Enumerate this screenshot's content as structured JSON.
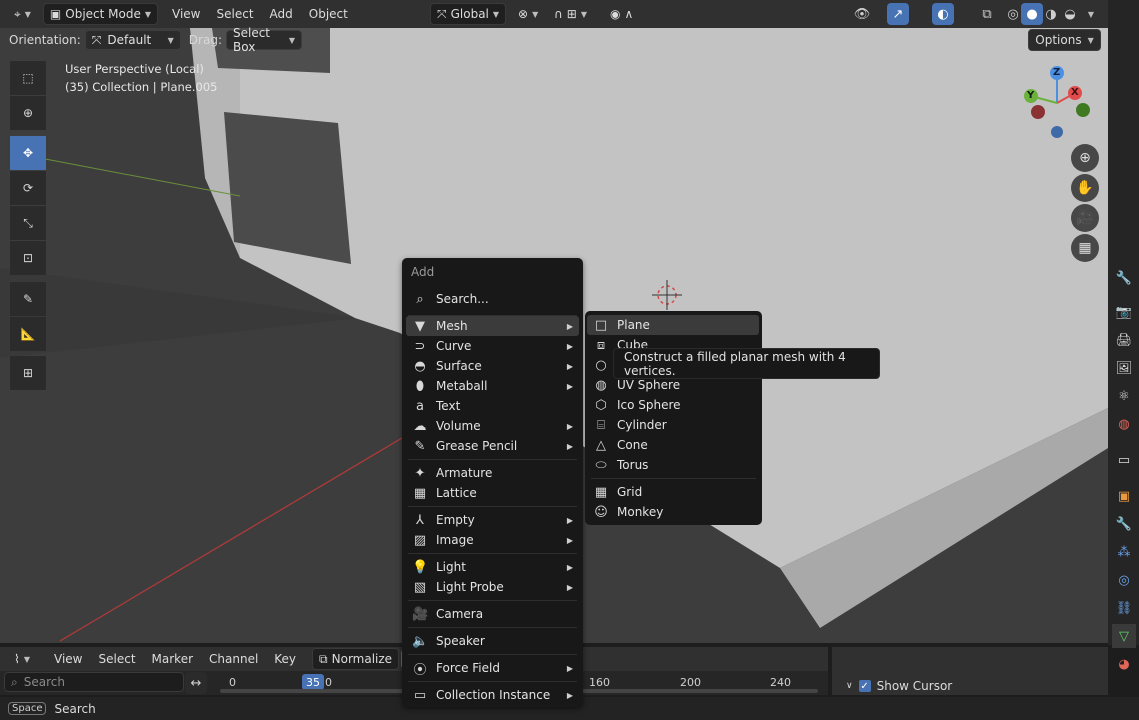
{
  "header": {
    "mode": "Object Mode",
    "menus": [
      "View",
      "Select",
      "Add",
      "Object"
    ],
    "transform_orientation": "Global"
  },
  "tool_settings": {
    "orientation_label": "Orientation:",
    "orientation_value": "Default",
    "drag_label": "Drag:",
    "drag_value": "Select Box",
    "options_label": "Options"
  },
  "viewport": {
    "perspective": "User Perspective (Local)",
    "collection": "(35) Collection | Plane.005",
    "gizmo": {
      "x": "X",
      "y": "Y",
      "z": "Z"
    }
  },
  "add_menu": {
    "title": "Add",
    "items": [
      {
        "label": "Search...",
        "icon": "search-icon",
        "submenu": false
      },
      {
        "label": "Mesh",
        "icon": "mesh-icon",
        "submenu": true
      },
      {
        "label": "Curve",
        "icon": "curve-icon",
        "submenu": true
      },
      {
        "label": "Surface",
        "icon": "surface-icon",
        "submenu": true
      },
      {
        "label": "Metaball",
        "icon": "metaball-icon",
        "submenu": true
      },
      {
        "label": "Text",
        "icon": "text-icon",
        "submenu": false
      },
      {
        "label": "Volume",
        "icon": "volume-icon",
        "submenu": true
      },
      {
        "label": "Grease Pencil",
        "icon": "grease-pencil-icon",
        "submenu": true
      },
      {
        "label": "Armature",
        "icon": "armature-icon",
        "submenu": false
      },
      {
        "label": "Lattice",
        "icon": "lattice-icon",
        "submenu": false
      },
      {
        "label": "Empty",
        "icon": "empty-icon",
        "submenu": true
      },
      {
        "label": "Image",
        "icon": "image-icon",
        "submenu": true
      },
      {
        "label": "Light",
        "icon": "light-icon",
        "submenu": true
      },
      {
        "label": "Light Probe",
        "icon": "light-probe-icon",
        "submenu": true
      },
      {
        "label": "Camera",
        "icon": "camera-icon",
        "submenu": false
      },
      {
        "label": "Speaker",
        "icon": "speaker-icon",
        "submenu": false
      },
      {
        "label": "Force Field",
        "icon": "force-field-icon",
        "submenu": true
      },
      {
        "label": "Collection Instance",
        "icon": "collection-instance-icon",
        "submenu": true
      }
    ]
  },
  "mesh_submenu": {
    "items": [
      {
        "label": "Plane",
        "icon": "plane-icon"
      },
      {
        "label": "Cube",
        "icon": "cube-icon"
      },
      {
        "label": "UV Sphere",
        "icon": "uv-sphere-icon"
      },
      {
        "label": "Ico Sphere",
        "icon": "ico-sphere-icon"
      },
      {
        "label": "Cylinder",
        "icon": "cylinder-icon"
      },
      {
        "label": "Cone",
        "icon": "cone-icon"
      },
      {
        "label": "Torus",
        "icon": "torus-icon"
      },
      {
        "label": "Grid",
        "icon": "grid-icon"
      },
      {
        "label": "Monkey",
        "icon": "monkey-icon"
      }
    ]
  },
  "tooltip": "Construct a filled planar mesh with 4 vertices.",
  "timeline": {
    "menus": [
      "View",
      "Select",
      "Marker",
      "Channel",
      "Key"
    ],
    "normalize_label": "Normalize",
    "search_placeholder": "Search",
    "current_frame": "35",
    "ticks": [
      "0",
      "0",
      "160",
      "200",
      "240"
    ],
    "show_cursor_label": "Show Cursor"
  },
  "status_bar": {
    "key": "Space",
    "action": "Search"
  },
  "colors": {
    "accent": "#4772b3",
    "menu_bg": "#181818",
    "viewport_bg": "#3d3d3d"
  }
}
